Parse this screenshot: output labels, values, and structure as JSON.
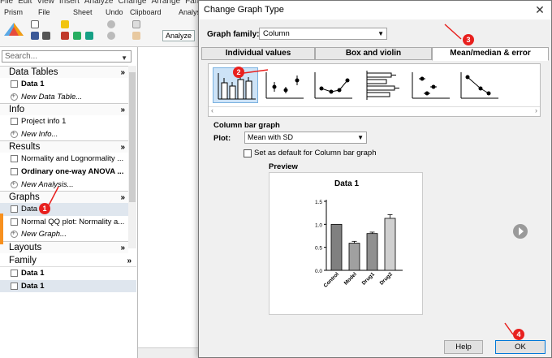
{
  "ribbon": {
    "menu": [
      "File",
      "Edit",
      "View",
      "Insert",
      "Analyze",
      "Change",
      "Arrange",
      "Family"
    ],
    "groups": [
      "Prism",
      "File",
      "Sheet",
      "Undo",
      "Clipboard",
      "Analysis"
    ],
    "analyze_label": "Analyze"
  },
  "navigator": {
    "search_placeholder": "Search...",
    "sections": [
      {
        "title": "Data Tables",
        "items": [
          {
            "label": "Data 1",
            "icon": "table",
            "style": "bold"
          },
          {
            "label": "New Data Table...",
            "icon": "plus",
            "style": "italic"
          }
        ]
      },
      {
        "title": "Info",
        "items": [
          {
            "label": "Project info 1",
            "icon": "info",
            "style": ""
          },
          {
            "label": "New Info...",
            "icon": "plus",
            "style": "italic"
          }
        ]
      },
      {
        "title": "Results",
        "items": [
          {
            "label": "Normality and Lognormality ...",
            "icon": "results",
            "style": ""
          },
          {
            "label": "Ordinary one-way ANOVA ...",
            "icon": "results",
            "style": "bold"
          },
          {
            "label": "New Analysis...",
            "icon": "plus",
            "style": "italic"
          }
        ]
      },
      {
        "title": "Graphs",
        "items": [
          {
            "label": "Data 1",
            "icon": "graph",
            "style": "sel"
          },
          {
            "label": "Normal QQ plot: Normality a...",
            "icon": "graph",
            "style": ""
          },
          {
            "label": "New Graph...",
            "icon": "plus",
            "style": "italic"
          }
        ]
      },
      {
        "title": "Layouts",
        "items": []
      }
    ],
    "family": {
      "title": "Family",
      "items": [
        {
          "label": "Data 1",
          "icon": "table",
          "style": "bold"
        },
        {
          "label": "Data 1",
          "icon": "graph",
          "style": "bold sel"
        }
      ]
    }
  },
  "dialog": {
    "title": "Change Graph Type",
    "graph_family_label": "Graph family:",
    "graph_family_value": "Column",
    "tabs": [
      "Individual values",
      "Box and violin",
      "Mean/median & error"
    ],
    "active_tab": 2,
    "section_heading": "Column bar graph",
    "plot_label": "Plot:",
    "plot_value": "Mean with SD",
    "default_checkbox_label": "Set as default for Column bar graph",
    "default_checked": false,
    "preview_label": "Preview",
    "help_label": "Help",
    "ok_label": "OK"
  },
  "chart_data": {
    "type": "bar",
    "title": "Data 1",
    "categories": [
      "Control",
      "Model",
      "Drug1",
      "Drug2"
    ],
    "values": [
      1.0,
      0.59,
      0.8,
      1.13
    ],
    "errors": [
      0.0,
      0.04,
      0.03,
      0.08
    ],
    "ylim": [
      0,
      1.5
    ],
    "yticks": [
      "0.0",
      "0.5",
      "1.0",
      "1.5"
    ],
    "colors": [
      "#808080",
      "#a0a0a0",
      "#909090",
      "#d0d0d0"
    ]
  },
  "annotations": [
    "1",
    "2",
    "3",
    "4"
  ],
  "colors": {
    "badge": "#e8201e",
    "selection": "#cde3f7",
    "accent_orange": "#f7901e"
  }
}
